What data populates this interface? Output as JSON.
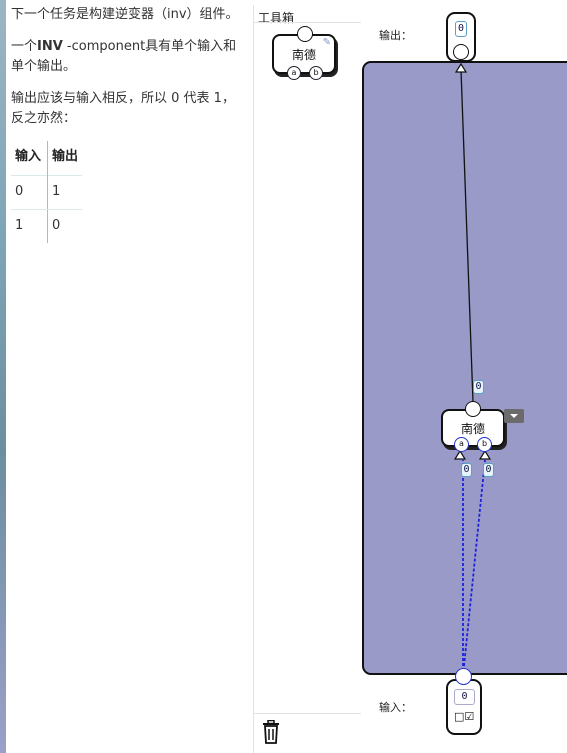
{
  "instructions": {
    "p1": "下一个任务是构建逆变器（inv）组件。",
    "p2_prefix": "一个",
    "p2_bold": "INV",
    "p2_suffix": " -component具有单个输入和单个输出。",
    "p3": "输出应该与输入相反，所以 0 代表 1，反之亦然："
  },
  "truth_table": {
    "headers": [
      "输入",
      "输出"
    ],
    "rows": [
      [
        "0",
        "1"
      ],
      [
        "1",
        "0"
      ]
    ]
  },
  "toolbox": {
    "title": "工具箱",
    "nand_label": "南德",
    "pin_a": "a",
    "pin_b": "b",
    "edit_icon": "pencil-icon",
    "trash_icon": "trash-icon"
  },
  "canvas": {
    "output_label": "输出：",
    "input_label": "输入：",
    "output_value": "0",
    "input_value": "0",
    "input_toggle": "□☑",
    "gate_label": "南德",
    "gate_pin_a": "a",
    "gate_pin_b": "b",
    "gate_output_value": "0",
    "pin_a_value": "0",
    "pin_b_value": "0",
    "board_color": "#9a9ac8",
    "wire_color": "#111111",
    "dashed_wire_color": "#1a22dd"
  }
}
